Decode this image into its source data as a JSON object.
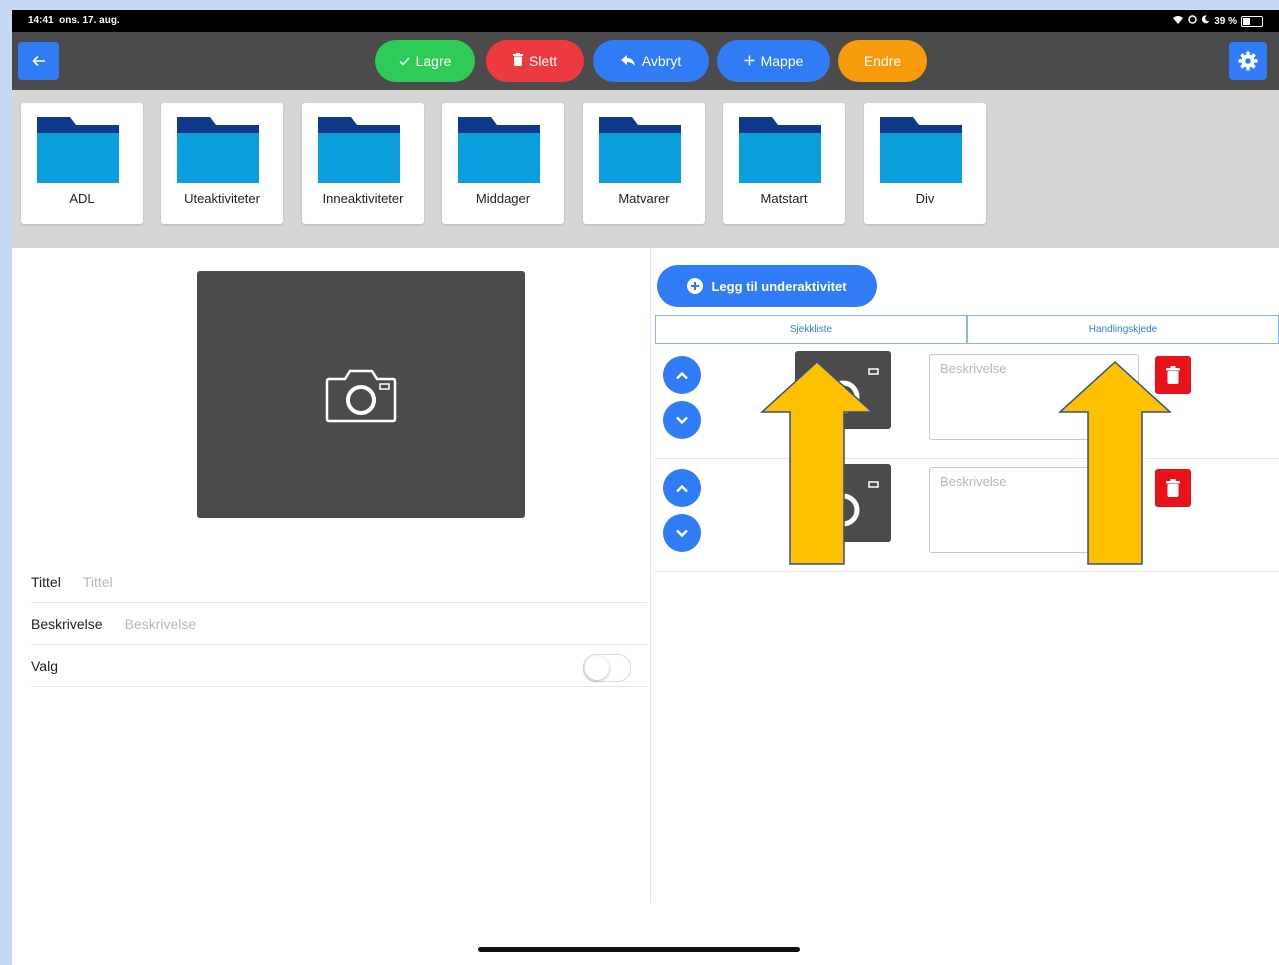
{
  "status_bar": {
    "time": "14:41",
    "date": "ons. 17. aug.",
    "battery": "39 %",
    "battery_level": 0.39
  },
  "toolbar": {
    "back_icon": "arrow-left-icon",
    "buttons": [
      {
        "label": "Lagre",
        "icon": "check-icon",
        "color": "#2ecc56"
      },
      {
        "label": "Slett",
        "icon": "trash-icon",
        "color": "#ec3a3f"
      },
      {
        "label": "Avbryt",
        "icon": "reply-icon",
        "color": "#2f7cf6"
      },
      {
        "label": "Mappe",
        "icon": "plus-icon",
        "color": "#2f7cf6"
      },
      {
        "label": "Endre",
        "icon": "",
        "color": "#f79a0c"
      }
    ],
    "settings_icon": "gear-icon"
  },
  "folders": [
    {
      "label": "ADL"
    },
    {
      "label": "Uteaktiviteter"
    },
    {
      "label": "Inneaktiviteter"
    },
    {
      "label": "Middager"
    },
    {
      "label": "Matvarer"
    },
    {
      "label": "Matstart"
    },
    {
      "label": "Div"
    }
  ],
  "form": {
    "title_label": "Tittel",
    "title_placeholder": "Tittel",
    "description_label": "Beskrivelse",
    "description_placeholder": "Beskrivelse",
    "choice_label": "Valg",
    "choice_on": false
  },
  "right_panel": {
    "add_sub_label": "Legg til underaktivitet",
    "tabs": [
      {
        "label": "Sjekkliste"
      },
      {
        "label": "Handlingskjede"
      }
    ],
    "sub_items": [
      {
        "description_placeholder": "Beskrivelse"
      },
      {
        "description_placeholder": "Beskrivelse"
      }
    ]
  },
  "colors": {
    "accent": "#2f7cf6",
    "toolbar_bg": "#4b4b4b",
    "folder_blue": "#0a9fdc",
    "folder_tab": "#0f3a8c",
    "delete_red": "#e8121b",
    "arrow_fill": "#ffc000",
    "arrow_stroke": "#2f528f"
  }
}
